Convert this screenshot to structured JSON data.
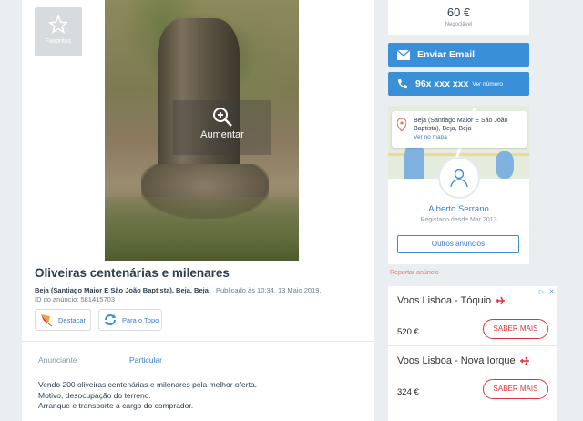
{
  "favorites": {
    "label": "Favoritos"
  },
  "photo": {
    "zoom_label": "Aumentar"
  },
  "listing": {
    "title": "Oliveiras centenárias e milenares",
    "location": "Beja (Santiago Maior E São João Baptista), Beja, Beja",
    "published": "Publicado às 10:34, 13 Maio 2019,",
    "ad_id": "ID do anúncio: 581415703",
    "actions": {
      "highlight": "Destacar",
      "to_top": "Para o Topo"
    },
    "seller_label": "Anunciante",
    "seller_type": "Particular",
    "description": [
      "Vendo 200 oliveiras centenárias e milenares pela melhor oferta.",
      "Motivo, desocupação do terreno.",
      "Arranque e transporte a cargo do comprador."
    ]
  },
  "sidebar": {
    "price": "60 €",
    "negotiable": "Negociável",
    "email_button": "Enviar Email",
    "phone": "96x xxx xxx",
    "see_number": "Ver número",
    "address": "Beja (Santiago Maior E São João Baptista), Beja, Beja",
    "see_map": "Ver no mapa",
    "user_name": "Alberto Serrano",
    "registered": "Registado desde Mar 2013",
    "other_ads": "Outros anúncios",
    "report": "Reportar anúncio"
  },
  "ad": {
    "rows": [
      {
        "destination": "Voos Lisboa - Tóquio",
        "price": "520 €",
        "cta": "SABER MAIS"
      },
      {
        "destination": "Voos Lisboa - Nova Iorque",
        "price": "324 €",
        "cta": "SABER MAIS"
      }
    ]
  },
  "colors": {
    "accent": "#3a8fd9",
    "ad_cta": "#e2333d",
    "report": "#e47a66"
  }
}
